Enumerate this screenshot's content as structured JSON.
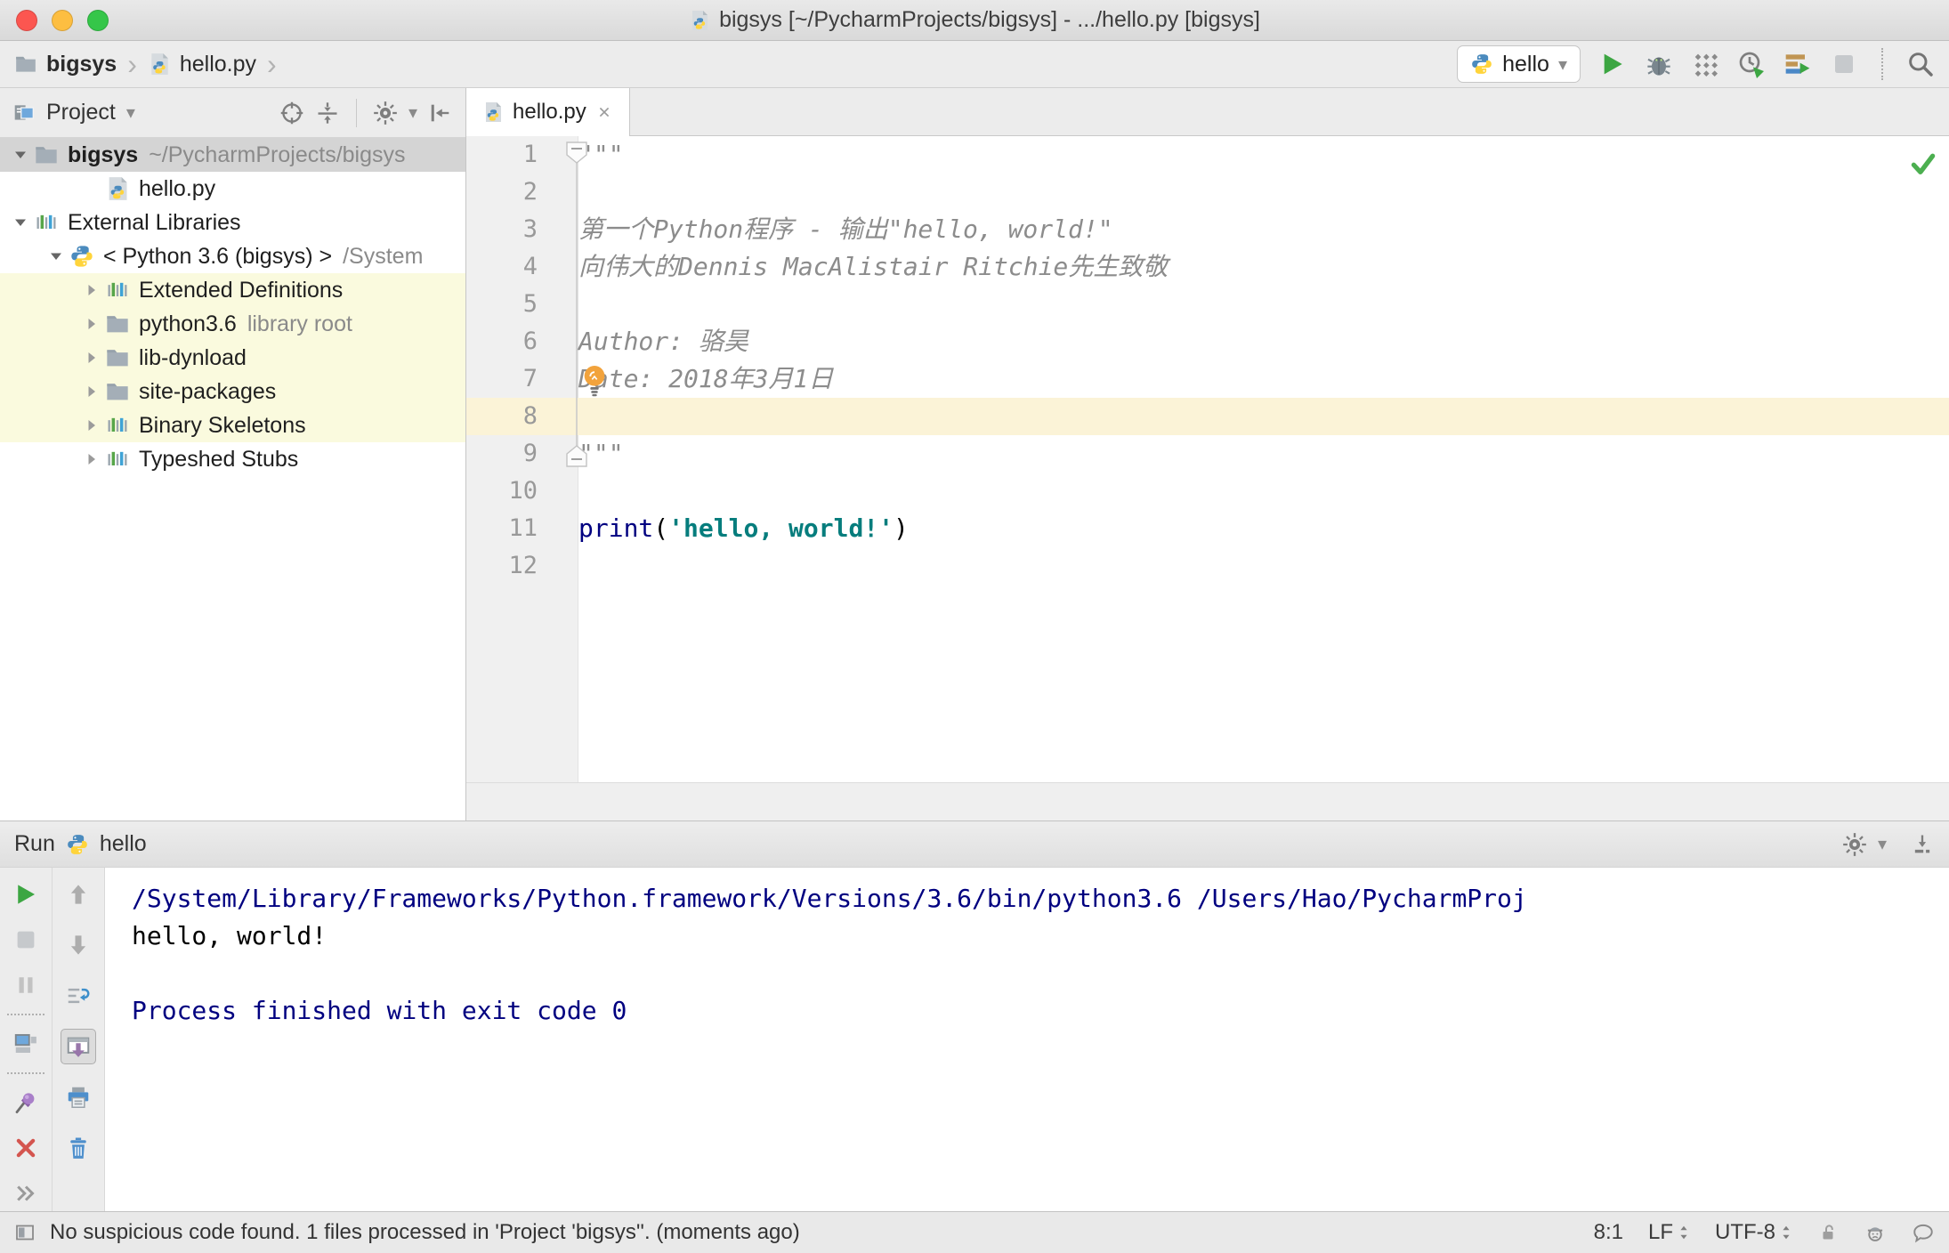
{
  "window_title": {
    "text": "bigsys [~/PycharmProjects/bigsys] - .../hello.py [bigsys]"
  },
  "icons_text": {
    "chevron_down": "▾",
    "breadcrumb_sep": "›"
  },
  "breadcrumbs": {
    "project": "bigsys",
    "file": "hello.py"
  },
  "toolbar": {
    "run_config": "hello"
  },
  "project_panel": {
    "title": "Project",
    "tree": [
      {
        "label": "bigsys",
        "hint": "~/PycharmProjects/bigsys",
        "icon": "folder",
        "expander": "open",
        "level": 0,
        "selected": true,
        "bold": true
      },
      {
        "label": "hello.py",
        "icon": "pyfile",
        "expander": "none",
        "level": 2
      },
      {
        "label": "External Libraries",
        "icon": "library",
        "expander": "open",
        "level": 0
      },
      {
        "label": "< Python 3.6 (bigsys) >",
        "hint": "/System",
        "icon": "python",
        "expander": "open",
        "level": 1
      },
      {
        "label": "Extended Definitions",
        "icon": "library",
        "expander": "closed",
        "level": 2,
        "highlight": true
      },
      {
        "label": "python3.6",
        "hint": "library root",
        "icon": "folder",
        "expander": "closed",
        "level": 2,
        "highlight": true
      },
      {
        "label": "lib-dynload",
        "icon": "folder",
        "expander": "closed",
        "level": 2,
        "highlight": true
      },
      {
        "label": "site-packages",
        "icon": "folder",
        "expander": "closed",
        "level": 2,
        "highlight": true
      },
      {
        "label": "Binary Skeletons",
        "icon": "library",
        "expander": "closed",
        "level": 2,
        "highlight": true
      },
      {
        "label": "Typeshed Stubs",
        "icon": "library",
        "expander": "closed",
        "level": 2
      }
    ]
  },
  "editor": {
    "tab": "hello.py",
    "lines": [
      {
        "num": 1,
        "segments": [
          {
            "text": "\"\"\"",
            "style": "docstring"
          }
        ],
        "fold": "start"
      },
      {
        "num": 2,
        "segments": []
      },
      {
        "num": 3,
        "segments": [
          {
            "text": "第一个Python程序 - 输出\"hello, world!\"",
            "style": "docstring"
          }
        ]
      },
      {
        "num": 4,
        "segments": [
          {
            "text": "向伟大的Dennis MacAlistair Ritchie先生致敬",
            "style": "docstring"
          }
        ]
      },
      {
        "num": 5,
        "segments": []
      },
      {
        "num": 6,
        "segments": [
          {
            "text": "Author: 骆昊",
            "style": "docstring"
          }
        ]
      },
      {
        "num": 7,
        "segments": [
          {
            "text": "Date: 2018年3月1日",
            "style": "docstring"
          }
        ],
        "bulb": true
      },
      {
        "num": 8,
        "segments": [],
        "current": true
      },
      {
        "num": 9,
        "segments": [
          {
            "text": "\"\"\"",
            "style": "docstring"
          }
        ],
        "fold": "end"
      },
      {
        "num": 10,
        "segments": []
      },
      {
        "num": 11,
        "segments": [
          {
            "text": "print",
            "style": "keyword"
          },
          {
            "text": "(",
            "style": "plain"
          },
          {
            "text": "'hello, world!'",
            "style": "string"
          },
          {
            "text": ")",
            "style": "plain"
          }
        ]
      },
      {
        "num": 12,
        "segments": []
      }
    ]
  },
  "run_panel": {
    "title": "Run",
    "config_name": "hello",
    "console": [
      {
        "text": "/System/Library/Frameworks/Python.framework/Versions/3.6/bin/python3.6 /Users/Hao/PycharmProj",
        "style": "system"
      },
      {
        "text": "hello, world!",
        "style": "stdout"
      },
      {
        "text": "",
        "style": "stdout"
      },
      {
        "text": "Process finished with exit code 0",
        "style": "system"
      }
    ]
  },
  "status_bar": {
    "message": "No suspicious code found. 1 files processed in 'Project 'bigsys''. (moments ago)",
    "caret_position": "8:1",
    "line_separator": "LF",
    "encoding": "UTF-8"
  },
  "colors": {
    "run_green": "#3CA642",
    "keyword_blue": "#000080",
    "string_teal": "#067D7D",
    "docstring_gray": "#8C8C8C",
    "console_system_blue": "#000080",
    "tree_selection": "#D4D4D4",
    "library_row_yellow": "#FAFADE",
    "caret_line_yellow": "#FBF3D7",
    "error_red": "#D4554F",
    "pin_purple": "#9876AA"
  }
}
